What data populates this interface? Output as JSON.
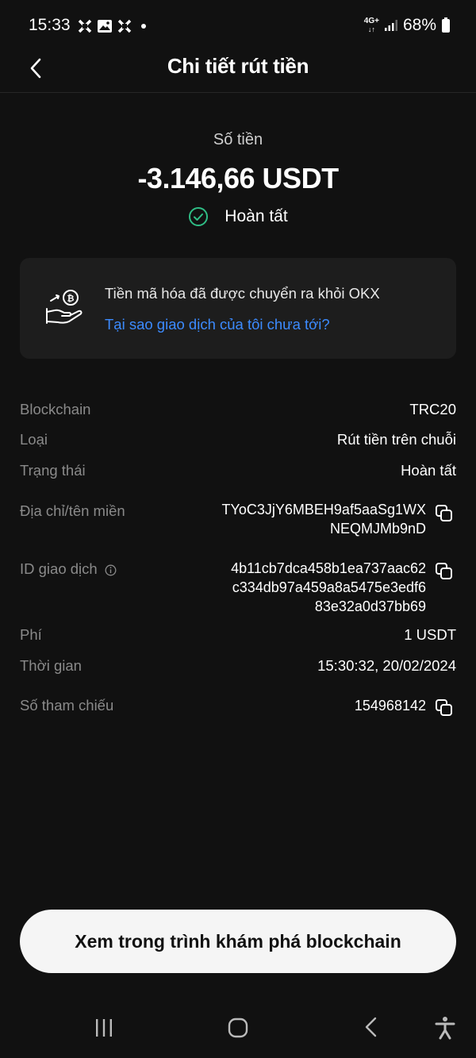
{
  "status_bar": {
    "time": "15:33",
    "network": "4G+",
    "battery": "68%"
  },
  "header": {
    "title": "Chi tiết rút tiền"
  },
  "summary": {
    "amount_label": "Số tiền",
    "amount": "-3.146,66 USDT",
    "status": "Hoàn tất",
    "status_color": "#2fbd85"
  },
  "info_card": {
    "message": "Tiền mã hóa đã được chuyển ra khỏi OKX",
    "link": "Tại sao giao dịch của tôi chưa tới?",
    "link_color": "#3c8bff"
  },
  "details": {
    "blockchain": {
      "label": "Blockchain",
      "value": "TRC20"
    },
    "type": {
      "label": "Loại",
      "value": "Rút tiền trên chuỗi"
    },
    "state": {
      "label": "Trạng thái",
      "value": "Hoàn tất"
    },
    "address": {
      "label": "Địa chỉ/tên miền",
      "line1": "TYoC3JjY6MBEH9af5aaSg1WX",
      "line2": "NEQMJMb9nD"
    },
    "tx_id": {
      "label": "ID giao dịch",
      "line1": "4b11cb7dca458b1ea737aac62",
      "line2": "c334db97a459a8a5475e3edf6",
      "line3": "83e32a0d37bb69"
    },
    "fee": {
      "label": "Phí",
      "value": "1 USDT"
    },
    "time": {
      "label": "Thời gian",
      "value": "15:30:32, 20/02/2024"
    },
    "reference": {
      "label": "Số tham chiếu",
      "value": "154968142"
    }
  },
  "actions": {
    "explorer_button": "Xem trong trình khám phá blockchain"
  }
}
